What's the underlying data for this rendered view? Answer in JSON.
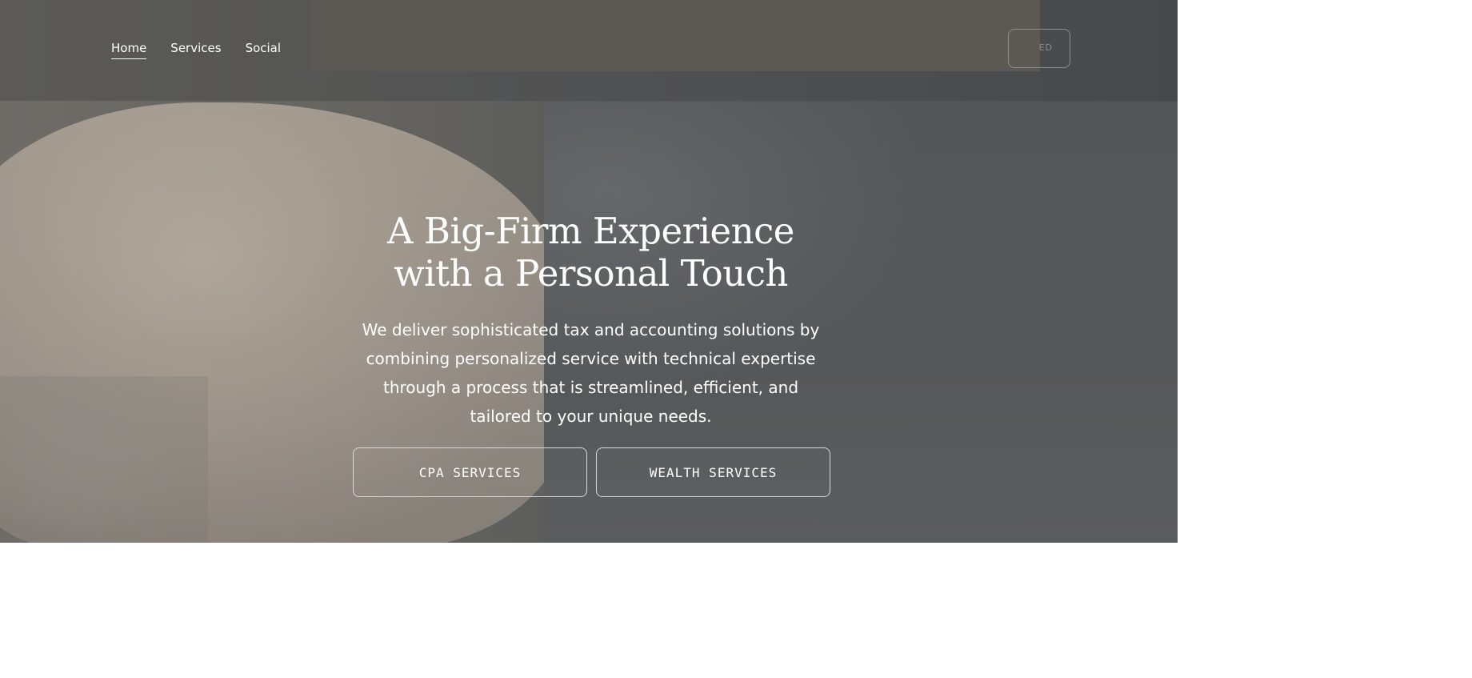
{
  "nav": {
    "items": [
      {
        "label": "Home",
        "active": true
      },
      {
        "label": "Services",
        "active": false
      },
      {
        "label": "Social",
        "active": false
      }
    ],
    "cta_partial_label": "ED"
  },
  "hero": {
    "title": "A Big-Firm Experience with a Personal Touch",
    "subtitle": "We deliver sophisticated tax and accounting solutions by combining personalized service with technical expertise through a process that is streamlined, efficient, and tailored to your unique needs.",
    "buttons": [
      {
        "label": "CPA SERVICES"
      },
      {
        "label": "WEALTH SERVICES"
      }
    ]
  },
  "colors": {
    "text": "#ffffff",
    "button_border": "#d9d9d9",
    "header_overlay": "#5c5955"
  }
}
